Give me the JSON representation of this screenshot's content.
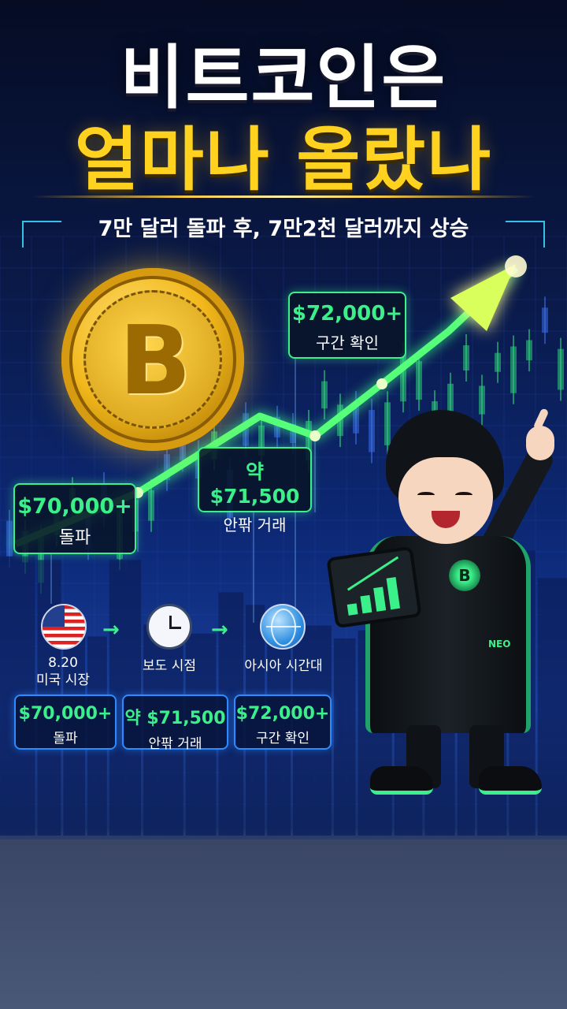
{
  "headline": {
    "line1": "비트코인은",
    "line2": "얼마나 올랐나"
  },
  "subtitle": "7만 달러 돌파 후, 7만2천 달러까지 상승",
  "coin": {
    "symbol": "B",
    "icon": "bitcoin-coin-icon"
  },
  "callouts": [
    {
      "value": "$70,000+",
      "label": "돌파"
    },
    {
      "value": "약 $71,500",
      "label": "안팎 거래"
    },
    {
      "value": "$72,000+",
      "label": "구간 확인"
    }
  ],
  "timeline": [
    {
      "icon": "us-flag-icon",
      "date": "8.20",
      "label": "미국 시장",
      "card_value": "$70,000+",
      "card_label": "돌파"
    },
    {
      "icon": "clock-icon",
      "label": "보도 시점",
      "card_value": "약 $71,500",
      "card_label": "안팎 거래"
    },
    {
      "icon": "globe-icon",
      "label": "아시아 시간대",
      "card_value": "$72,000+",
      "card_label": "구간 확인"
    }
  ],
  "character": {
    "badge": "B",
    "coat_text": "NEO"
  },
  "colors": {
    "accent_green": "#3bf08a",
    "title_yellow": "#ffd21f",
    "card_border_blue": "#2d8bff",
    "background_navy": "#0a1a4a"
  }
}
